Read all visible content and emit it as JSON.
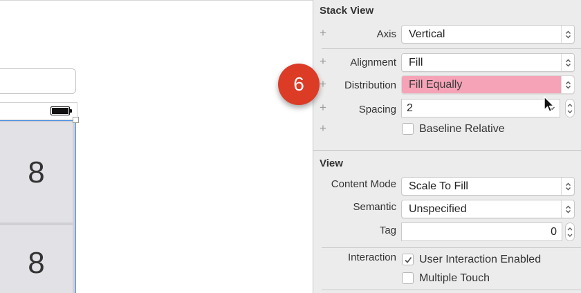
{
  "canvas": {
    "cells": [
      "8",
      "8"
    ]
  },
  "badge": {
    "number": "6"
  },
  "inspector": {
    "stack_view": {
      "title": "Stack View",
      "axis": {
        "label": "Axis",
        "value": "Vertical"
      },
      "alignment": {
        "label": "Alignment",
        "value": "Fill"
      },
      "distribution": {
        "label": "Distribution",
        "value": "Fill Equally",
        "highlight_color": "#f6a3b7"
      },
      "spacing": {
        "label": "Spacing",
        "value": "2"
      },
      "baseline_relative": {
        "label": "Baseline Relative",
        "checked": false
      }
    },
    "view": {
      "title": "View",
      "content_mode": {
        "label": "Content Mode",
        "value": "Scale To Fill"
      },
      "semantic": {
        "label": "Semantic",
        "value": "Unspecified"
      },
      "tag": {
        "label": "Tag",
        "value": "0"
      },
      "interaction": {
        "label": "Interaction",
        "user_interaction_enabled": {
          "label": "User Interaction Enabled",
          "checked": true
        },
        "multiple_touch": {
          "label": "Multiple Touch",
          "checked": false
        }
      }
    }
  },
  "icons": {
    "plus": "+",
    "checkmark": "✓"
  }
}
